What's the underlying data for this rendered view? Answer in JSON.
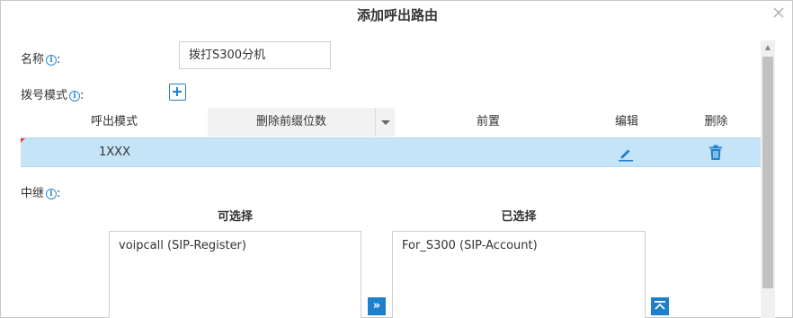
{
  "dialog": {
    "title": "添加呼出路由"
  },
  "form": {
    "name_label": "名称",
    "name_colon": ":",
    "name_value": "拨打S300分机",
    "pattern_label": "拨号模式",
    "pattern_colon": ":",
    "trunk_label": "中继",
    "trunk_colon": ":"
  },
  "table": {
    "headers": [
      "呼出模式",
      "删除前缀位数",
      "前置",
      "编辑",
      "删除"
    ],
    "rows": [
      {
        "pattern": "1XXX",
        "strip": "",
        "prepend": ""
      }
    ]
  },
  "trunks": {
    "available_title": "可选择",
    "selected_title": "已选择",
    "available": [
      "voipcall (SIP-Register)"
    ],
    "selected": [
      "For_S300 (SIP-Account)"
    ]
  },
  "icons": {
    "info": "info-icon",
    "add": "plus-icon",
    "edit": "pencil-icon",
    "delete": "trash-icon",
    "move_right": "double-chevron-right-icon",
    "move_top": "move-to-top-icon",
    "close": "close-icon"
  },
  "colors": {
    "accent": "#1e7fcb",
    "row_highlight": "#c6e4f7"
  }
}
